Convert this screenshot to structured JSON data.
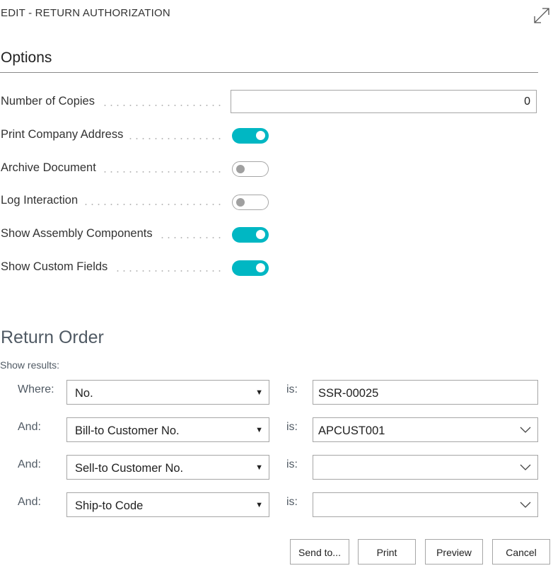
{
  "window": {
    "title": "EDIT - RETURN AUTHORIZATION",
    "expand_icon": "expand-icon"
  },
  "options": {
    "heading": "Options",
    "number_of_copies": {
      "label": "Number of Copies",
      "value": "0"
    },
    "print_company_address": {
      "label": "Print Company Address",
      "checked": true
    },
    "archive_document": {
      "label": "Archive Document",
      "checked": false
    },
    "log_interaction": {
      "label": "Log Interaction",
      "checked": false
    },
    "show_assembly_components": {
      "label": "Show Assembly Components",
      "checked": true
    },
    "show_custom_fields": {
      "label": "Show Custom Fields",
      "checked": true
    }
  },
  "return_order": {
    "heading": "Return Order",
    "show_results": "Show results:",
    "filters": [
      {
        "prefix": "Where:",
        "field": "No.",
        "is": "is:",
        "value": "SSR-00025",
        "has_dropdown": false
      },
      {
        "prefix": "And:",
        "field": "Bill-to Customer No.",
        "is": "is:",
        "value": "APCUST001",
        "has_dropdown": true
      },
      {
        "prefix": "And:",
        "field": "Sell-to Customer No.",
        "is": "is:",
        "value": "",
        "has_dropdown": true
      },
      {
        "prefix": "And:",
        "field": "Ship-to Code",
        "is": "is:",
        "value": "",
        "has_dropdown": true
      }
    ]
  },
  "buttons": {
    "send_to": "Send to...",
    "print": "Print",
    "preview": "Preview",
    "cancel": "Cancel"
  },
  "colors": {
    "toggle_on": "#00b7c3",
    "border": "#a6a6a6",
    "muted_text": "#505a64"
  }
}
